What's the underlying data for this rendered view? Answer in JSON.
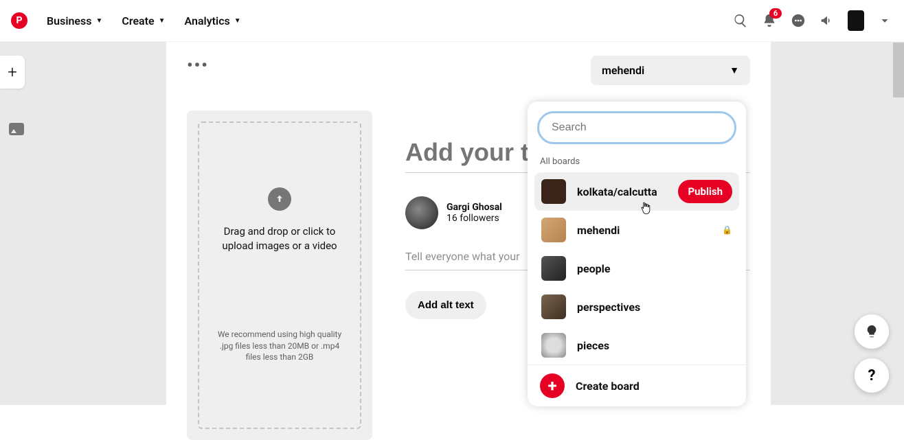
{
  "header": {
    "nav": [
      {
        "label": "Business"
      },
      {
        "label": "Create"
      },
      {
        "label": "Analytics"
      }
    ],
    "notification_count": "6"
  },
  "card": {
    "selected_board": "mehendi",
    "title_placeholder": "Add your title",
    "description_placeholder": "Tell everyone what your",
    "alt_button": "Add alt text",
    "upload": {
      "main_text": "Drag and drop or click to upload images or a video",
      "hint": "We recommend using high quality .jpg files less than 20MB or .mp4 files less than 2GB"
    },
    "profile": {
      "name": "Gargi Ghosal",
      "followers": "16 followers"
    }
  },
  "dropdown": {
    "search_placeholder": "Search",
    "section_label": "All boards",
    "publish_label": "Publish",
    "create_label": "Create board",
    "boards": [
      {
        "name": "kolkata/calcutta",
        "active": true
      },
      {
        "name": "mehendi",
        "locked": true
      },
      {
        "name": "people"
      },
      {
        "name": "perspectives"
      },
      {
        "name": "pieces"
      }
    ]
  }
}
